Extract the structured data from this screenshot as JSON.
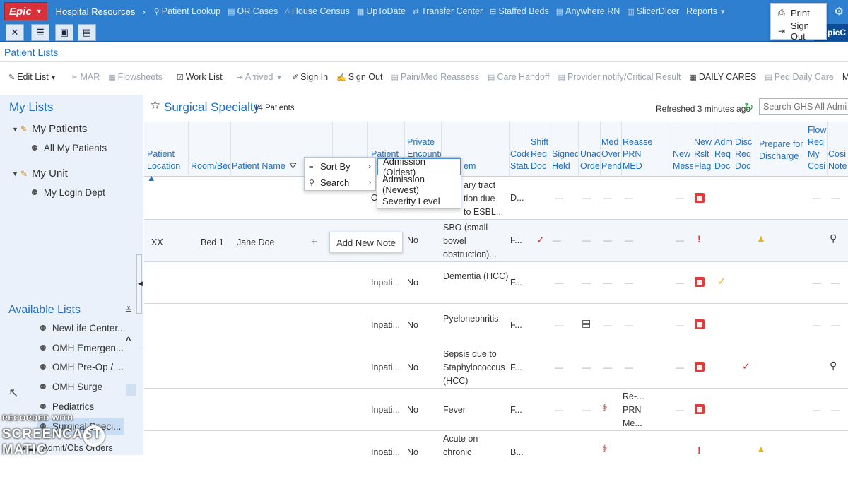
{
  "topbar": {
    "epic_label": "Epic",
    "breadcrumb": "Hospital Resources",
    "separator": "›",
    "links": [
      {
        "label": "Patient Lookup",
        "icon": "person-icon"
      },
      {
        "label": "OR Cases",
        "icon": "document-icon"
      },
      {
        "label": "House Census",
        "icon": "house-icon"
      },
      {
        "label": "UpToDate",
        "icon": "book-icon"
      },
      {
        "label": "Transfer Center",
        "icon": "transfer-icon"
      },
      {
        "label": "Staffed Beds",
        "icon": "bed-icon"
      },
      {
        "label": "Anywhere RN",
        "icon": "document-icon"
      },
      {
        "label": "SlicerDicer",
        "icon": "chart-icon"
      },
      {
        "label": "Reports",
        "icon": "caret-icon"
      }
    ],
    "logo_tail": "picC"
  },
  "user_menu": {
    "print_label": "Print",
    "signout_label": "Sign Out"
  },
  "activity": {
    "title": "Patient Lists"
  },
  "actionbar": {
    "edit_list": "Edit List",
    "mar": "MAR",
    "flowsheets": "Flowsheets",
    "work_list": "Work List",
    "arrived": "Arrived",
    "sign_in": "Sign In",
    "sign_out": "Sign Out",
    "pain_med": "Pain/Med Reassess",
    "care_handoff": "Care Handoff",
    "provider_notify": "Provider notify/Critical Result",
    "daily_cares": "DAILY CARES",
    "ped_daily_care": "Ped Daily Care",
    "more": "More"
  },
  "sidebar": {
    "my_lists_title": "My Lists",
    "my_patients": "My Patients",
    "all_my_patients": "All My Patients",
    "my_unit": "My Unit",
    "my_login_dept": "My Login Dept",
    "available_title": "Available Lists",
    "available_items": [
      "NewLife Center...",
      "OMH Emergen...",
      "OMH Pre-Op / ...",
      "OMH Surge",
      "Pediatrics",
      "Surgical Speci...",
      "Admit/Obs Orders"
    ],
    "watermark_top": "RECORDED WITH",
    "watermark_bottom": "SCREENCAST  MATIC"
  },
  "patient_list": {
    "title": "Surgical Specialty",
    "count": "14 Patients",
    "refreshed": "Refreshed 3 minutes ago",
    "search_placeholder": "Search GHS All Admi"
  },
  "columns": {
    "patient_location": "Patient\nLocation ▲",
    "room_bed": "Room/Bed",
    "patient_name": "Patient Name",
    "patient_class": "Patient",
    "private_encounter": "Private\nEncounter",
    "problem": "em",
    "code_status": "Code\nStatus",
    "shift_req_doc": "Shift\nReq\nDoc",
    "signed_held": "Signed\nHeld",
    "unack_orders": "Unack\nOrders",
    "med_overdue": "Med\nOver\nPend",
    "reassess_prn": "Reasse\nPRN\nMED",
    "new_messages": "New\nMess",
    "new_rslt_flag": "New\nRslt\nFlag",
    "adm_req_doc": "Adm\nReq\nDoc",
    "disc_req_doc": "Disc\nReq\nDoc",
    "prepare_discharge": "Prepare for\nDischarge",
    "flow_req_cosign": "Flow\nReq\nMy\nCosi",
    "cosign_note": "Cosi\nNote"
  },
  "rows": [
    {
      "location": "",
      "room": "",
      "name": "",
      "class": "O",
      "private": "",
      "problem": "ary tract\ntion due\nto ESBL...",
      "code": "D..."
    },
    {
      "location": "XX",
      "room": "Bed 1",
      "name": "Jane Doe",
      "class": "",
      "private": "No",
      "problem": "SBO (small\nbowel\nobstruction)...",
      "code": "F..."
    },
    {
      "location": "",
      "room": "",
      "name": "",
      "class": "Inpati...",
      "private": "No",
      "problem": "Dementia (HCC)",
      "code": "F..."
    },
    {
      "location": "",
      "room": "",
      "name": "",
      "class": "Inpati...",
      "private": "No",
      "problem": "Pyelonephritis",
      "code": "F..."
    },
    {
      "location": "",
      "room": "",
      "name": "",
      "class": "Inpati...",
      "private": "No",
      "problem": "Sepsis due to\nStaphylococcus\n(HCC)",
      "code": "F..."
    },
    {
      "location": "",
      "room": "",
      "name": "",
      "class": "Inpati...",
      "private": "No",
      "problem": "Fever",
      "code": "F...",
      "reassess": "Re-...\nPRN\nMe..."
    },
    {
      "location": "",
      "room": "",
      "name": "",
      "class": "Inpati...",
      "private": "No",
      "problem": "Acute on chronic\nsystolic",
      "code": "B..."
    }
  ],
  "context_menu": {
    "sort_by": "Sort By",
    "search": "Search",
    "sort_options": [
      "Admission (Oldest)",
      "Admission (Newest)",
      "Severity Level"
    ]
  },
  "tooltip": {
    "add_new_note": "Add New Note",
    "plus": "+"
  },
  "colors": {
    "topbar": "#2e7fcf",
    "epic_red": "#d8313a",
    "link_blue": "#1f6fc2",
    "sidebar_bg": "#eaf1fa",
    "alert_red": "#e03a3a",
    "warn_yellow": "#e8b31a"
  }
}
